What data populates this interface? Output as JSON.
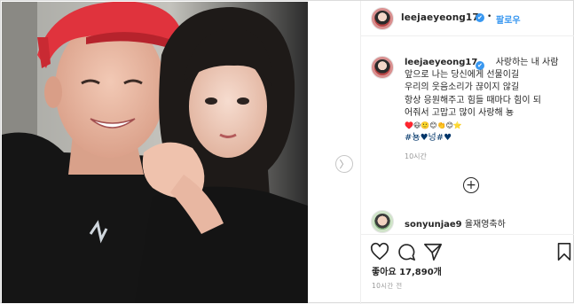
{
  "post": {
    "author": "leejaeyeong17",
    "follow_label": "팔로우",
    "dot": "•",
    "verified_mark": "✔",
    "caption": {
      "author": "leejaeyeong17",
      "lines": [
        "사랑하는 내 사람",
        "앞으로 나는 당신에게 선물이길",
        "우리의 웃음소리가 끊이지 않길",
        "항상 응원해주고 힘들 때마다 힘이 되",
        "어줘서 고맙고 많이 사랑해 뇽",
        "♥️😃🙂😊👏😊⭐️"
      ],
      "hashtags": "#뇽♥넝#♥"
    },
    "caption_time": "10시간",
    "comment": {
      "user": "sonyunjae9",
      "text": "율재영축하"
    },
    "likes": "좋아요 17,890개",
    "post_time": "10시간 전"
  },
  "icons": {
    "next": "chevron-right-icon",
    "load_more": "plus-circle-icon",
    "like": "heart-icon",
    "comment": "comment-icon",
    "share": "share-icon",
    "save": "bookmark-icon"
  },
  "colors": {
    "link": "#3897f0",
    "hashtag": "#003569",
    "muted": "#999999"
  }
}
